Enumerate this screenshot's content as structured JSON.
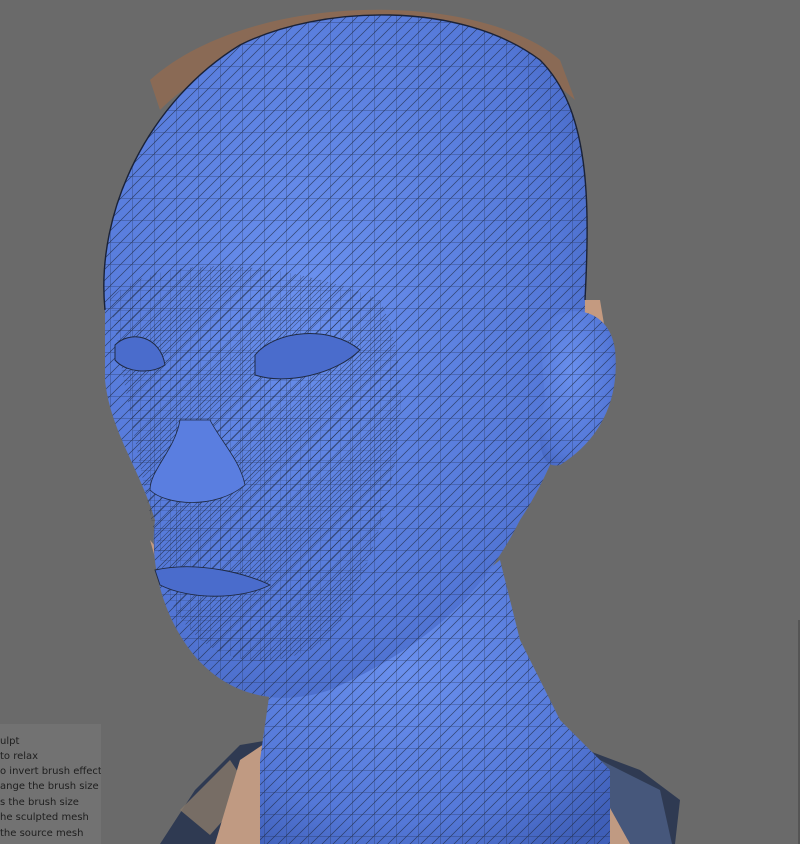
{
  "viewport": {
    "background": "#6a6a6a",
    "mesh_color": "#5b80e0",
    "wire_color": "#1f2a44",
    "skin_color": "#c49a80",
    "cloth_color": "#2e3a55"
  },
  "help_panel": {
    "lines": [
      "ulpt",
      "to relax",
      "o invert brush effect",
      "ange the brush size",
      "s the brush size",
      "he sculpted mesh",
      "the source mesh"
    ]
  }
}
